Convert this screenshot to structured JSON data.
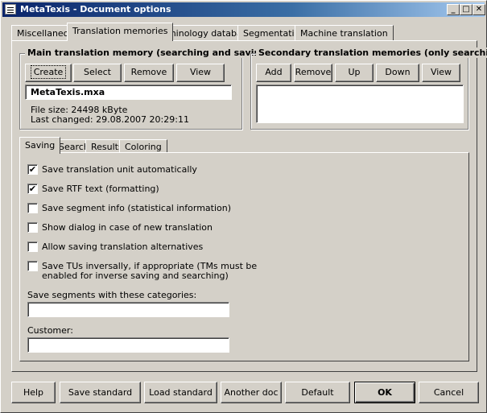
{
  "window": {
    "title": "MetaTexis - Document options"
  },
  "title_buttons": {
    "minimize": "_",
    "maximize": "□",
    "close": "✕"
  },
  "tabs": [
    "Miscellaneous",
    "Translation memories",
    "Terminology databases",
    "Segmentation",
    "Machine translation"
  ],
  "main_tm": {
    "legend": "Main translation memory (searching and saving)",
    "buttons": [
      "Create",
      "Select",
      "Remove",
      "View"
    ],
    "file_name": "MetaTexis.mxa",
    "file_size": "File size: 24498 kByte",
    "last_changed": "Last changed: 29.08.2007 20:29:11"
  },
  "secondary_tm": {
    "legend": "Secondary translation memories (only searching)",
    "buttons": [
      "Add",
      "Remove",
      "Up",
      "Down",
      "View"
    ]
  },
  "subtabs": [
    "Saving",
    "Search",
    "Results",
    "Coloring"
  ],
  "options": [
    {
      "label": "Save translation unit automatically",
      "checked": true
    },
    {
      "label": "Save RTF text (formatting)",
      "checked": true
    },
    {
      "label": "Save segment info (statistical information)",
      "checked": false
    },
    {
      "label": "Show dialog in case of new translation",
      "checked": false
    },
    {
      "label": "Allow saving translation alternatives",
      "checked": false
    },
    {
      "label": "Save TUs inversally, if appropriate (TMs must be",
      "label2": "enabled for inverse saving and searching)",
      "checked": false
    }
  ],
  "categories": {
    "label": "Save segments with these categories:",
    "value": ""
  },
  "customer": {
    "label": "Customer:",
    "value": ""
  },
  "bottom_buttons": [
    "Help",
    "Save standard",
    "Load standard",
    "Another doc",
    "Default",
    "OK",
    "Cancel"
  ],
  "check_mark": "✔"
}
